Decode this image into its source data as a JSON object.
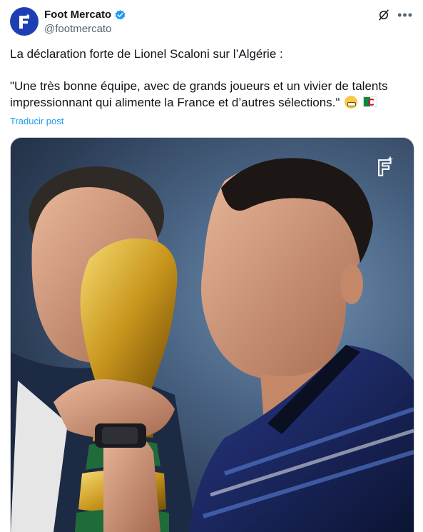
{
  "account": {
    "display_name": "Foot Mercato",
    "handle": "@footmercato",
    "verified": true
  },
  "icons": {
    "avatar": "foot-mercato-logo-icon",
    "verified": "verified-badge-icon",
    "grok": "grok-icon",
    "more": "more-options-icon"
  },
  "post": {
    "line1": "La déclaration forte de Lionel Scaloni sur l’Algérie :",
    "quote": "\"Une très bonne équipe, avec de grands joueurs et un vivier de talents impressionnant qui alimente la France et d’autres sélections.\"",
    "emojis": [
      "grimacing-face",
      "flag-algeria"
    ],
    "translate_label": "Traducir post"
  },
  "media": {
    "type": "photo",
    "watermark": "foot-mercato-logo"
  },
  "colors": {
    "brand_blue": "#1e3fb4",
    "link_blue": "#1d9bf0",
    "text": "#0f1419",
    "muted": "#536471"
  }
}
